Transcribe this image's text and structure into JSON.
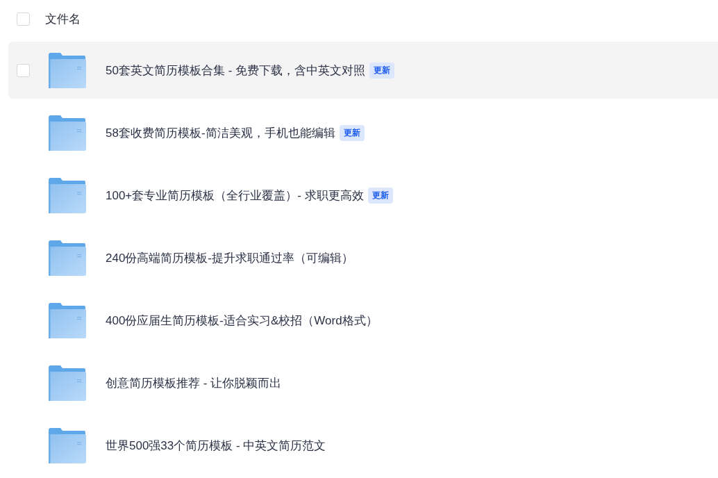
{
  "header": {
    "select_all": {
      "checked": false
    },
    "label": "文件名"
  },
  "files": [
    {
      "name": "50套英文简历模板合集 - 免费下载，含中英文对照",
      "badge": "更新",
      "hovered": true,
      "checked": false
    },
    {
      "name": "58套收费简历模板-简洁美观，手机也能编辑",
      "badge": "更新",
      "hovered": false
    },
    {
      "name": "100+套专业简历模板（全行业覆盖）- 求职更高效",
      "badge": "更新",
      "hovered": false
    },
    {
      "name": "240份高端简历模板-提升求职通过率（可编辑）",
      "hovered": false
    },
    {
      "name": "400份应届生简历模板-适合实习&校招（Word格式）",
      "hovered": false
    },
    {
      "name": "创意简历模板推荐 - 让你脱颖而出",
      "hovered": false
    },
    {
      "name": "世界500强33个简历模板 - 中英文简历范文",
      "hovered": false
    }
  ]
}
